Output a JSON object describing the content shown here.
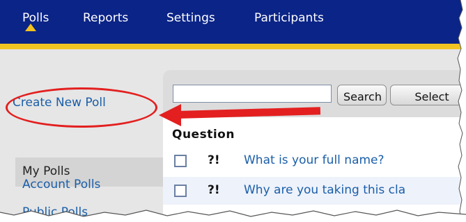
{
  "nav": {
    "items": [
      "Polls",
      "Reports",
      "Settings",
      "Participants"
    ],
    "active": "Polls"
  },
  "sidebar": {
    "create_label": "Create New Poll",
    "items": [
      "My Polls",
      "Account Polls",
      "Public Polls"
    ],
    "selected": "My Polls"
  },
  "toolbar": {
    "search_value": "",
    "search_button": "Search",
    "select_button": "Select"
  },
  "table": {
    "column_header": "Question",
    "rows": [
      {
        "icon": "?!",
        "text": "What is your full name?"
      },
      {
        "icon": "?!",
        "text": "Why are you taking this cla"
      }
    ]
  },
  "colors": {
    "nav_bg": "#0b2487",
    "accent_line": "#f2c422",
    "link": "#1a5ea8",
    "callout": "#e31f1f"
  }
}
